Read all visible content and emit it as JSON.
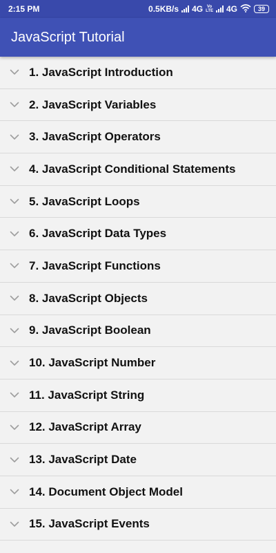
{
  "status_bar": {
    "time": "2:15 PM",
    "speed": "0.5KB/s",
    "network1": "4G",
    "volte_top": "Vo",
    "volte_bottom": "LTE",
    "network2": "4G",
    "battery": "39"
  },
  "app_bar": {
    "title": "JavaScript Tutorial"
  },
  "colors": {
    "status_bar": "#3949ab",
    "app_bar": "#3f51b5",
    "list_background": "#f2f2f2",
    "divider": "#d9d9d9"
  },
  "list": {
    "items": [
      {
        "label": "1. JavaScript Introduction",
        "icon": "chevron-down-icon"
      },
      {
        "label": "2. JavaScript Variables",
        "icon": "chevron-down-icon"
      },
      {
        "label": "3. JavaScript Operators",
        "icon": "chevron-down-icon"
      },
      {
        "label": "4. JavaScript Conditional Statements",
        "icon": "chevron-down-icon"
      },
      {
        "label": "5. JavaScript Loops",
        "icon": "chevron-down-icon"
      },
      {
        "label": "6. JavaScript Data Types",
        "icon": "chevron-down-icon"
      },
      {
        "label": "7. JavaScript Functions",
        "icon": "chevron-down-icon"
      },
      {
        "label": "8. JavaScript Objects",
        "icon": "chevron-down-icon"
      },
      {
        "label": "9. JavaScript Boolean",
        "icon": "chevron-down-icon"
      },
      {
        "label": "10. JavaScript Number",
        "icon": "chevron-down-icon"
      },
      {
        "label": "11. JavaScript String",
        "icon": "chevron-down-icon"
      },
      {
        "label": "12. JavaScript Array",
        "icon": "chevron-down-icon"
      },
      {
        "label": "13. JavaScript Date",
        "icon": "chevron-down-icon"
      },
      {
        "label": "14. Document Object Model",
        "icon": "chevron-down-icon"
      },
      {
        "label": "15. JavaScript Events",
        "icon": "chevron-down-icon"
      }
    ]
  }
}
